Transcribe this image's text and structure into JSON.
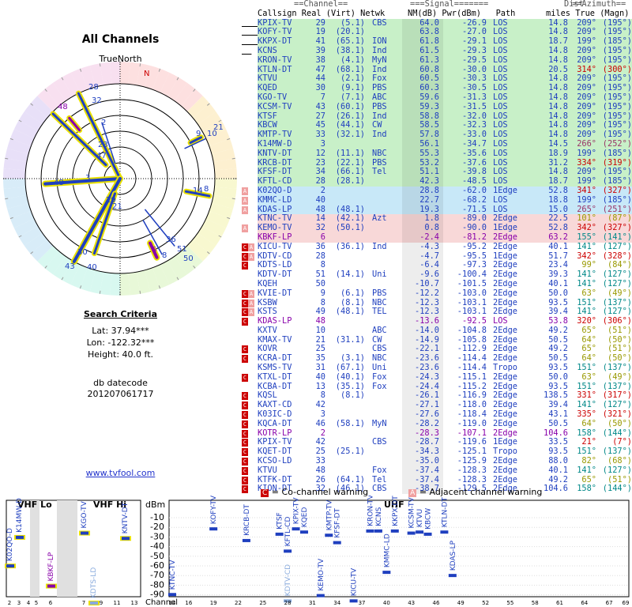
{
  "title": "All Channels",
  "compass_label": "TrueNorth",
  "north_mark": "N",
  "search": {
    "heading": "Search Criteria",
    "lat": "Lat: 37.94***",
    "lon": "Lon: -122.32***",
    "height": "Height: 40.0 ft.",
    "db_label": "db datecode",
    "db_value": "201207061717"
  },
  "link": "www.tvfool.com",
  "headers": {
    "group1": "Callsign Real (Virt) Netwk",
    "group2": "NM(dB) Pwr(dBm)   Path",
    "group3": "miles True (Magn)",
    "top_channel": "==Channel==",
    "top_signal": "===Signal=======",
    "top_dist": "Dist",
    "top_azimuth": "==Azimuth=="
  },
  "colors": {
    "green": "#c8f0c8",
    "blue": "#c8e8f8",
    "pink": "#f8d8d8",
    "gray": "#e0e0e0",
    "text_blue": "#1f3fbf",
    "text_red": "#cc0000",
    "text_purple": "#8800aa",
    "text_olive": "#999900",
    "text_teal": "#008888"
  },
  "stations": [
    [
      "KPIX-TV",
      "29",
      "(5.1)",
      "CBS",
      "64.0",
      "-26.9",
      "LOS",
      "14.8",
      "209°",
      "(195°)",
      "g",
      ""
    ],
    [
      "KOFY-TV",
      "19",
      "(20.1)",
      "",
      "63.8",
      "-27.0",
      "LOS",
      "14.8",
      "209°",
      "(195°)",
      "g",
      ""
    ],
    [
      "KKPX-DT",
      "41",
      "(65.1)",
      "ION",
      "61.8",
      "-29.1",
      "LOS",
      "18.7",
      "199°",
      "(185°)",
      "g",
      ""
    ],
    [
      "KCNS",
      "39",
      "(38.1)",
      "Ind",
      "61.5",
      "-29.3",
      "LOS",
      "14.8",
      "209°",
      "(195°)",
      "g",
      ""
    ],
    [
      "KRON-TV",
      "38",
      "(4.1)",
      "MyN",
      "61.3",
      "-29.5",
      "LOS",
      "14.8",
      "209°",
      "(195°)",
      "g",
      ""
    ],
    [
      "KTLN-DT",
      "47",
      "(68.1)",
      "Ind",
      "60.8",
      "-30.0",
      "LOS",
      "20.5",
      "314°",
      "(300°)",
      "g",
      ""
    ],
    [
      "KTVU",
      "44",
      "(2.1)",
      "Fox",
      "60.5",
      "-30.3",
      "LOS",
      "14.8",
      "209°",
      "(195°)",
      "g",
      ""
    ],
    [
      "KQED",
      "30",
      "(9.1)",
      "PBS",
      "60.3",
      "-30.5",
      "LOS",
      "14.8",
      "209°",
      "(195°)",
      "g",
      ""
    ],
    [
      "KGO-TV",
      "7",
      "(7.1)",
      "ABC",
      "59.6",
      "-31.3",
      "LOS",
      "14.8",
      "209°",
      "(195°)",
      "g",
      ""
    ],
    [
      "KCSM-TV",
      "43",
      "(60.1)",
      "PBS",
      "59.3",
      "-31.5",
      "LOS",
      "14.8",
      "209°",
      "(195°)",
      "g",
      ""
    ],
    [
      "KTSF",
      "27",
      "(26.1)",
      "Ind",
      "58.8",
      "-32.0",
      "LOS",
      "14.8",
      "209°",
      "(195°)",
      "g",
      ""
    ],
    [
      "KBCW",
      "45",
      "(44.1)",
      "CW",
      "58.5",
      "-32.3",
      "LOS",
      "14.8",
      "209°",
      "(195°)",
      "g",
      ""
    ],
    [
      "KMTP-TV",
      "33",
      "(32.1)",
      "Ind",
      "57.8",
      "-33.0",
      "LOS",
      "14.8",
      "209°",
      "(195°)",
      "g",
      ""
    ],
    [
      "K14MW-D",
      "3",
      "",
      "",
      "56.1",
      "-34.7",
      "LOS",
      "14.5",
      "266°",
      "(252°)",
      "g",
      ""
    ],
    [
      "KNTV-DT",
      "12",
      "(11.1)",
      "NBC",
      "55.3",
      "-35.6",
      "LOS",
      "18.9",
      "199°",
      "(185°)",
      "g",
      ""
    ],
    [
      "KRCB-DT",
      "23",
      "(22.1)",
      "PBS",
      "53.2",
      "-37.6",
      "LOS",
      "31.2",
      "334°",
      "(319°)",
      "g",
      ""
    ],
    [
      "KFSF-DT",
      "34",
      "(66.1)",
      "Tel",
      "51.1",
      "-39.8",
      "LOS",
      "14.8",
      "209°",
      "(195°)",
      "g",
      ""
    ],
    [
      "KFTL-CD",
      "28",
      "(28.1)",
      "",
      "42.3",
      "-48.5",
      "LOS",
      "18.7",
      "199°",
      "(185°)",
      "g",
      ""
    ],
    [
      "K02QO-D",
      "2",
      "",
      "",
      "28.8",
      "-62.0",
      "1Edge",
      "52.8",
      "341°",
      "(327°)",
      "b",
      "A"
    ],
    [
      "KMMC-LD",
      "40",
      "",
      "",
      "22.7",
      "-68.2",
      "LOS",
      "18.8",
      "199°",
      "(185°)",
      "b",
      "A"
    ],
    [
      "KDAS-LP",
      "48",
      "(48.1)",
      "",
      "19.3",
      "-71.5",
      "LOS",
      "15.0",
      "265°",
      "(251°)",
      "b",
      "A"
    ],
    [
      "KTNC-TV",
      "14",
      "(42.1)",
      "Azt",
      "1.8",
      "-89.0",
      "2Edge",
      "22.5",
      "101°",
      "(87°)",
      "p",
      ""
    ],
    [
      "KEMO-TV",
      "32",
      "(50.1)",
      "",
      "0.8",
      "-90.0",
      "1Edge",
      "52.8",
      "342°",
      "(327°)",
      "p",
      "A"
    ],
    [
      "KBKF-LP",
      "6",
      "",
      "",
      "-2.4",
      "-81.2",
      "2Edge",
      "63.2",
      "155°",
      "(141°)",
      "p",
      ""
    ],
    [
      "KICU-TV",
      "36",
      "(36.1)",
      "Ind",
      "-4.3",
      "-95.2",
      "2Edge",
      "40.1",
      "141°",
      "(127°)",
      "w",
      "CA"
    ],
    [
      "KDTV-CD",
      "28",
      "",
      "",
      "-4.7",
      "-95.5",
      "1Edge",
      "51.7",
      "342°",
      "(328°)",
      "w",
      "CA"
    ],
    [
      "KDTS-LD",
      "8",
      "",
      "",
      "-6.4",
      "-97.3",
      "2Edge",
      "23.4",
      "99°",
      "(84°)",
      "w",
      "C"
    ],
    [
      "KDTV-DT",
      "51",
      "(14.1)",
      "Uni",
      "-9.6",
      "-100.4",
      "2Edge",
      "39.3",
      "141°",
      "(127°)",
      "w",
      ""
    ],
    [
      "KQEH",
      "50",
      "",
      "",
      "-10.7",
      "-101.5",
      "2Edge",
      "40.1",
      "141°",
      "(127°)",
      "w",
      ""
    ],
    [
      "KVIE-DT",
      "9",
      "(6.1)",
      "PBS",
      "-12.2",
      "-103.0",
      "2Edge",
      "50.0",
      "63°",
      "(49°)",
      "w",
      "CA"
    ],
    [
      "KSBW",
      "8",
      "(8.1)",
      "NBC",
      "-12.3",
      "-103.1",
      "2Edge",
      "93.5",
      "151°",
      "(137°)",
      "w",
      "CA"
    ],
    [
      "KSTS",
      "49",
      "(48.1)",
      "TEL",
      "-12.3",
      "-103.1",
      "2Edge",
      "39.4",
      "141°",
      "(127°)",
      "w",
      "CA"
    ],
    [
      "KDAS-LP",
      "48",
      "",
      "",
      "-13.6",
      "-92.5",
      "LOS",
      "53.8",
      "320°",
      "(306°)",
      "w",
      "C"
    ],
    [
      "KXTV",
      "10",
      "",
      "ABC",
      "-14.0",
      "-104.8",
      "2Edge",
      "49.2",
      "65°",
      "(51°)",
      "w",
      ""
    ],
    [
      "KMAX-TV",
      "21",
      "(31.1)",
      "CW",
      "-14.9",
      "-105.8",
      "2Edge",
      "50.5",
      "64°",
      "(50°)",
      "w",
      ""
    ],
    [
      "KOVR",
      "25",
      "",
      "CBS",
      "-22.1",
      "-112.9",
      "2Edge",
      "49.2",
      "65°",
      "(51°)",
      "w",
      "C"
    ],
    [
      "KCRA-DT",
      "35",
      "(3.1)",
      "NBC",
      "-23.6",
      "-114.4",
      "2Edge",
      "50.5",
      "64°",
      "(50°)",
      "w",
      "C"
    ],
    [
      "KSMS-TV",
      "31",
      "(67.1)",
      "Uni",
      "-23.6",
      "-114.4",
      "Tropo",
      "93.5",
      "151°",
      "(137°)",
      "w",
      ""
    ],
    [
      "KTXL-DT",
      "40",
      "(40.1)",
      "Fox",
      "-24.3",
      "-115.1",
      "2Edge",
      "50.0",
      "63°",
      "(49°)",
      "w",
      "C"
    ],
    [
      "KCBA-DT",
      "13",
      "(35.1)",
      "Fox",
      "-24.4",
      "-115.2",
      "2Edge",
      "93.5",
      "151°",
      "(137°)",
      "w",
      ""
    ],
    [
      "KQSL",
      "8",
      "(8.1)",
      "",
      "-26.1",
      "-116.9",
      "2Edge",
      "138.5",
      "331°",
      "(317°)",
      "w",
      "C"
    ],
    [
      "KAXT-CD",
      "42",
      "",
      "",
      "-27.1",
      "-118.0",
      "2Edge",
      "39.4",
      "141°",
      "(127°)",
      "w",
      "C"
    ],
    [
      "K03IC-D",
      "3",
      "",
      "",
      "-27.6",
      "-118.4",
      "2Edge",
      "43.1",
      "335°",
      "(321°)",
      "w",
      "C"
    ],
    [
      "KQCA-DT",
      "46",
      "(58.1)",
      "MyN",
      "-28.2",
      "-119.0",
      "2Edge",
      "50.5",
      "64°",
      "(50°)",
      "w",
      "C"
    ],
    [
      "KOTR-LP",
      "2",
      "",
      "",
      "-28.3",
      "-107.1",
      "2Edge",
      "104.6",
      "158°",
      "(144°)",
      "w",
      "C"
    ],
    [
      "KPIX-TV",
      "42",
      "",
      "CBS",
      "-28.7",
      "-119.6",
      "1Edge",
      "33.5",
      "21°",
      "(7°)",
      "w",
      "C"
    ],
    [
      "KQET-DT",
      "25",
      "(25.1)",
      "",
      "-34.3",
      "-125.1",
      "Tropo",
      "93.5",
      "151°",
      "(137°)",
      "w",
      "C"
    ],
    [
      "KCSO-LD",
      "33",
      "",
      "",
      "-35.0",
      "-125.9",
      "2Edge",
      "88.0",
      "82°",
      "(68°)",
      "w",
      "C"
    ],
    [
      "KTVU",
      "48",
      "",
      "Fox",
      "-37.4",
      "-128.3",
      "2Edge",
      "40.1",
      "141°",
      "(127°)",
      "w",
      "C"
    ],
    [
      "KTFK-DT",
      "26",
      "(64.1)",
      "Tel",
      "-37.4",
      "-128.3",
      "2Edge",
      "49.2",
      "65°",
      "(51°)",
      "w",
      "C"
    ],
    [
      "KION-DT",
      "32",
      "(46.1)",
      "CBS",
      "-38.7",
      "-129.5",
      "2Edge",
      "104.6",
      "158°",
      "(144°)",
      "w",
      "C"
    ]
  ],
  "polar_labels": [
    {
      "t": "28",
      "c": "#1f3fbf"
    },
    {
      "t": "32",
      "c": "#1f3fbf"
    },
    {
      "t": "48",
      "c": "#8800aa"
    },
    {
      "t": "2",
      "c": "#1f3fbf"
    },
    {
      "t": "23",
      "c": "#1f3fbf"
    },
    {
      "t": "47",
      "c": "#1f3fbf"
    },
    {
      "t": "21",
      "c": "#1f3fbf"
    },
    {
      "t": "9",
      "c": "#1f3fbf"
    },
    {
      "t": "10",
      "c": "#1f3fbf"
    },
    {
      "t": "48",
      "c": "#1f3fbf"
    },
    {
      "t": "3",
      "c": "#1f3fbf"
    },
    {
      "t": "14",
      "c": "#1f3fbf"
    },
    {
      "t": "8",
      "c": "#1f3fbf"
    },
    {
      "t": "29",
      "c": "#1f3fbf"
    },
    {
      "t": "21",
      "c": "#1f3fbf"
    },
    {
      "t": "36",
      "c": "#1f3fbf"
    },
    {
      "t": "51",
      "c": "#1f3fbf"
    },
    {
      "t": "50",
      "c": "#1f3fbf"
    },
    {
      "t": "6",
      "c": "#8800aa"
    },
    {
      "t": "8",
      "c": "#1f3fbf"
    },
    {
      "t": "40",
      "c": "#1f3fbf"
    },
    {
      "t": "43",
      "c": "#1f3fbf"
    },
    {
      "t": "30",
      "c": "#1f3fbf"
    }
  ],
  "legend": {
    "cochannel_mark": "C",
    "cochannel": "= Co-channel warning",
    "adjacent_mark": "A",
    "adjacent": "= Adjacent channel warning"
  },
  "bottom_chart": {
    "vhf_lo": "VHF Lo",
    "vhf_hi": "VHF Hi",
    "uhf": "UHF",
    "dbm": "dBm",
    "channel_label": "Channel",
    "y_ticks": [
      "-10",
      "-20",
      "-30",
      "-40",
      "-50",
      "-60",
      "-70",
      "-80",
      "-90"
    ],
    "vhf_ticks": [
      "2",
      "3",
      "4",
      "5",
      "6",
      "7",
      "9",
      "11",
      "13"
    ],
    "uhf_ticks": [
      "14",
      "16",
      "19",
      "22",
      "25",
      "28",
      "31",
      "34",
      "37",
      "40",
      "43",
      "46",
      "49",
      "52",
      "55",
      "58",
      "61",
      "64",
      "67",
      "69"
    ],
    "vhf_stations": [
      {
        "name": "K02QO-D",
        "ch": 2,
        "dbm": -62,
        "c": "#1f3fbf"
      },
      {
        "name": "K14MW-D",
        "ch": 3,
        "dbm": -35,
        "c": "#1f3fbf"
      },
      {
        "name": "KBKF-LP",
        "ch": 6,
        "dbm": -81,
        "c": "#8800aa"
      },
      {
        "name": "KGO-TV",
        "ch": 7,
        "dbm": -31,
        "c": "#1f3fbf"
      },
      {
        "name": "KDTS-LD",
        "ch": 8,
        "dbm": -97,
        "c": "#88aadd"
      },
      {
        "name": "KNTV-DT",
        "ch": 12,
        "dbm": -36,
        "c": "#1f3fbf"
      }
    ],
    "uhf_stations": [
      {
        "name": "KTNC-TV",
        "ch": 14,
        "dbm": -89,
        "c": "#1f3fbf"
      },
      {
        "name": "KOFY-TV",
        "ch": 19,
        "dbm": -27,
        "c": "#1f3fbf"
      },
      {
        "name": "KRCB-DT",
        "ch": 23,
        "dbm": -38,
        "c": "#1f3fbf"
      },
      {
        "name": "KTSF",
        "ch": 27,
        "dbm": -32,
        "c": "#1f3fbf"
      },
      {
        "name": "KFTL-CD",
        "ch": 28,
        "dbm": -48,
        "c": "#1f3fbf"
      },
      {
        "name": "KDTV-CD",
        "ch": 28,
        "dbm": -95,
        "c": "#88aadd"
      },
      {
        "name": "KPIX-TV",
        "ch": 29,
        "dbm": -27,
        "c": "#1f3fbf"
      },
      {
        "name": "KQED",
        "ch": 30,
        "dbm": -30,
        "c": "#1f3fbf"
      },
      {
        "name": "KEMO-TV",
        "ch": 32,
        "dbm": -90,
        "c": "#1f3fbf"
      },
      {
        "name": "KMTP-TV",
        "ch": 33,
        "dbm": -33,
        "c": "#1f3fbf"
      },
      {
        "name": "KFSF-DT",
        "ch": 34,
        "dbm": -40,
        "c": "#1f3fbf"
      },
      {
        "name": "KICU-TV",
        "ch": 36,
        "dbm": -95,
        "c": "#1f3fbf"
      },
      {
        "name": "KRON-TV",
        "ch": 38,
        "dbm": -29,
        "c": "#1f3fbf"
      },
      {
        "name": "KCNS",
        "ch": 39,
        "dbm": -29,
        "c": "#1f3fbf"
      },
      {
        "name": "KMMC-LD",
        "ch": 40,
        "dbm": -68,
        "c": "#1f3fbf"
      },
      {
        "name": "KKPX-DT",
        "ch": 41,
        "dbm": -29,
        "c": "#1f3fbf"
      },
      {
        "name": "KCSM-TV",
        "ch": 43,
        "dbm": -31,
        "c": "#1f3fbf"
      },
      {
        "name": "KTVU",
        "ch": 44,
        "dbm": -30,
        "c": "#1f3fbf"
      },
      {
        "name": "KBCW",
        "ch": 45,
        "dbm": -32,
        "c": "#1f3fbf"
      },
      {
        "name": "KTLN-DT",
        "ch": 47,
        "dbm": -30,
        "c": "#1f3fbf"
      },
      {
        "name": "KDAS-LP",
        "ch": 48,
        "dbm": -71,
        "c": "#1f3fbf"
      }
    ]
  }
}
